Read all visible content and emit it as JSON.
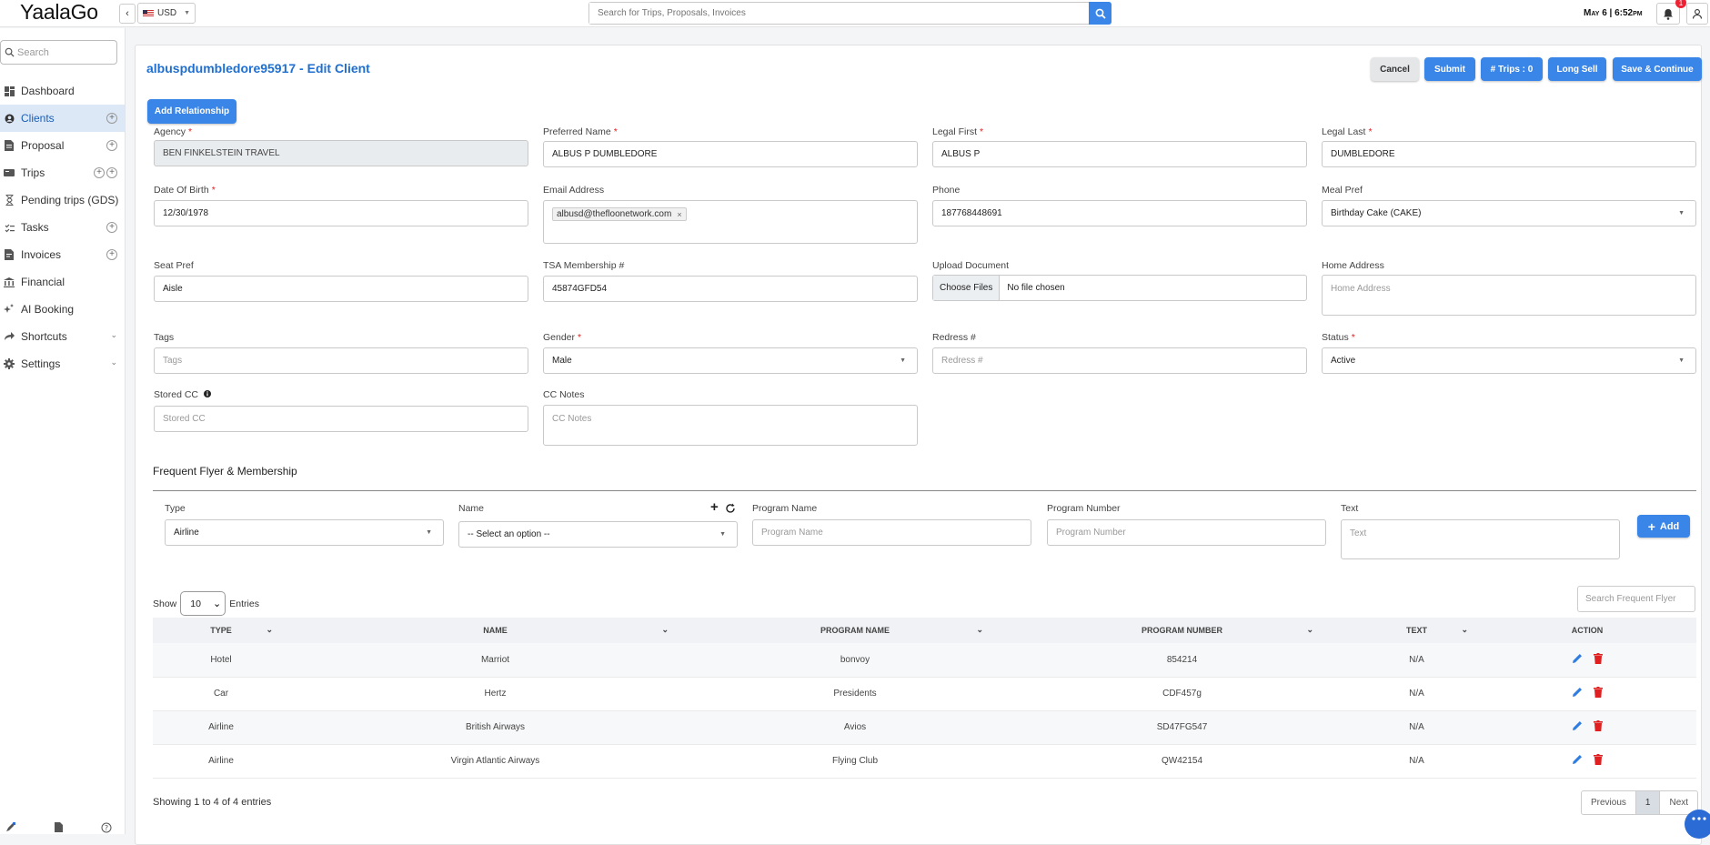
{
  "app": {
    "logo": "YaalaGo"
  },
  "topbar": {
    "currency": "USD",
    "search_placeholder": "Search for Trips, Proposals, Invoices",
    "datetime": "May 6 | 6:52pm",
    "notification_count": "1"
  },
  "sidebar": {
    "search_placeholder": "Search",
    "items": [
      {
        "label": "Dashboard",
        "icon": "dashboard-icon"
      },
      {
        "label": "Clients",
        "icon": "clients-icon"
      },
      {
        "label": "Proposal",
        "icon": "proposal-icon"
      },
      {
        "label": "Trips",
        "icon": "trips-icon"
      },
      {
        "label": "Pending trips (GDS)",
        "icon": "hourglass-icon"
      },
      {
        "label": "Tasks",
        "icon": "tasks-icon"
      },
      {
        "label": "Invoices",
        "icon": "invoice-icon"
      },
      {
        "label": "Financial",
        "icon": "bank-icon"
      },
      {
        "label": "AI Booking",
        "icon": "ai-icon"
      },
      {
        "label": "Shortcuts",
        "icon": "shortcut-icon"
      },
      {
        "label": "Settings",
        "icon": "gear-icon"
      }
    ]
  },
  "page": {
    "title": "albuspdumbledore95917 - Edit Client",
    "buttons": {
      "cancel": "Cancel",
      "submit": "Submit",
      "trips": "# Trips : 0",
      "long_sell": "Long Sell",
      "save_continue": "Save & Continue",
      "add_relationship": "Add Relationship"
    }
  },
  "form": {
    "agency": {
      "label": "Agency",
      "value": "BEN FINKELSTEIN TRAVEL"
    },
    "preferred_name": {
      "label": "Preferred Name",
      "value": "ALBUS P DUMBLEDORE"
    },
    "legal_first": {
      "label": "Legal First",
      "value": "ALBUS P"
    },
    "legal_last": {
      "label": "Legal Last",
      "value": "DUMBLEDORE"
    },
    "dob": {
      "label": "Date Of Birth",
      "value": "12/30/1978"
    },
    "email": {
      "label": "Email Address",
      "value": "albusd@thefloonetwork.com"
    },
    "phone": {
      "label": "Phone",
      "value": "187768448691"
    },
    "meal_pref": {
      "label": "Meal Pref",
      "value": "Birthday Cake (CAKE)"
    },
    "seat_pref": {
      "label": "Seat Pref",
      "value": "Aisle"
    },
    "tsa": {
      "label": "TSA Membership #",
      "value": "45874GFD54"
    },
    "upload": {
      "label": "Upload Document",
      "button": "Choose Files",
      "status": "No file chosen"
    },
    "home_address": {
      "label": "Home Address",
      "placeholder": "Home Address"
    },
    "tags": {
      "label": "Tags",
      "placeholder": "Tags"
    },
    "gender": {
      "label": "Gender",
      "value": "Male"
    },
    "redress": {
      "label": "Redress #",
      "placeholder": "Redress #"
    },
    "status": {
      "label": "Status",
      "value": "Active"
    },
    "stored_cc": {
      "label": "Stored CC",
      "placeholder": "Stored CC"
    },
    "cc_notes": {
      "label": "CC Notes",
      "placeholder": "CC Notes"
    }
  },
  "frequent_flyer": {
    "section_title": "Frequent Flyer & Membership",
    "type": {
      "label": "Type",
      "value": "Airline"
    },
    "name": {
      "label": "Name",
      "value": "-- Select an option --"
    },
    "program_name": {
      "label": "Program Name",
      "placeholder": "Program Name"
    },
    "program_number": {
      "label": "Program Number",
      "placeholder": "Program Number"
    },
    "text": {
      "label": "Text",
      "placeholder": "Text"
    },
    "add_button": "Add",
    "show_label": "Show",
    "entries_value": "10",
    "entries_label": "Entries",
    "search_placeholder": "Search Frequent Flyer",
    "columns": [
      "Type",
      "Name",
      "Program Name",
      "Program Number",
      "Text",
      "Action"
    ],
    "rows": [
      {
        "type": "Hotel",
        "name": "Marriot",
        "program_name": "bonvoy",
        "program_number": "854214",
        "text": "N/A"
      },
      {
        "type": "Car",
        "name": "Hertz",
        "program_name": "Presidents",
        "program_number": "CDF457g",
        "text": "N/A"
      },
      {
        "type": "Airline",
        "name": "British Airways",
        "program_name": "Avios",
        "program_number": "SD47FG547",
        "text": "N/A"
      },
      {
        "type": "Airline",
        "name": "Virgin Atlantic Airways",
        "program_name": "Flying Club",
        "program_number": "QW42154",
        "text": "N/A"
      }
    ],
    "info": "Showing 1 to 4 of 4 entries",
    "pager": {
      "previous": "Previous",
      "current": "1",
      "next": "Next"
    }
  },
  "colors": {
    "accent": "#3a86e8",
    "title": "#1f6fd1",
    "required": "#e02020",
    "delete": "#e02020"
  }
}
